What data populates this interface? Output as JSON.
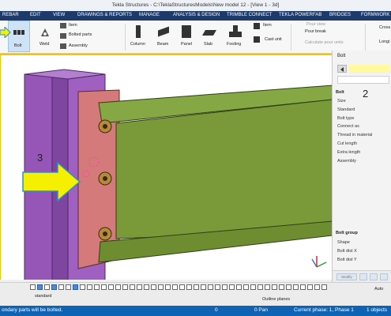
{
  "window": {
    "title": "Tekla Structures - C:\\TeklaStructuresModels\\New model 12 - [View 1 - 3d]"
  },
  "menu": {
    "items": [
      "REBAR",
      "EDIT",
      "VIEW",
      "DRAWINGS & REPORTS",
      "MANAGE",
      "ANALYSIS & DESIGN",
      "TRIMBLE CONNECT",
      "TEKLA POWERFAB",
      "BRIDGES",
      "FORMWORK"
    ]
  },
  "ribbon": {
    "bolt": "Bolt",
    "weld": "Weld",
    "item": "Item",
    "bolted_parts": "Bolted parts",
    "assembly": "Assembly",
    "column": "Column",
    "beam": "Beam",
    "panel": "Panel",
    "slab": "Slab",
    "footing": "Footing",
    "item2": "Item",
    "cast_unit": "Cast unit",
    "pour_view": "Pour view",
    "pour_break": "Pour break",
    "calculate_pour_units": "Calculate pour units",
    "cross": "Cross",
    "longi": "Longi"
  },
  "panel": {
    "title": "Bolt",
    "bolt_section": "Bolt",
    "bolt_props": [
      "Size",
      "Standard",
      "Bolt type",
      "Connect as",
      "Thread in material",
      "Cut length",
      "Extra length",
      "Assembly"
    ],
    "group_section": "Bolt group",
    "group_props": [
      "Shape",
      "Bolt dist X",
      "Bolt dist Y"
    ],
    "footer_modify": "Modify",
    "footer_auto": "Auto"
  },
  "annotations": {
    "num2": "2",
    "num3": "3"
  },
  "toolbar": {
    "standard": "standard",
    "outline_planes": "Outline planes",
    "auto": "Auto"
  },
  "status": {
    "message": "ondary parts will be bolted.",
    "zero": "0",
    "pan": "0 Pan",
    "phase": "Current phase: 1, Phase 1",
    "objects": "1 objects"
  },
  "colors": {
    "accent": "#0f63b5",
    "menu_bg": "#1d3a6b",
    "column_purple": "#9656b8",
    "end_plate": "#d47a7a",
    "beam_green": "#7a9a3a",
    "highlight_yellow": "#f5f000"
  }
}
